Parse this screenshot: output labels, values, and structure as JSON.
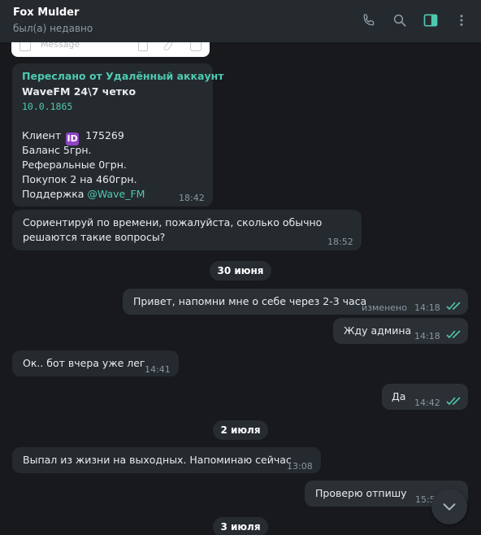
{
  "header": {
    "title": "Fox Mulder",
    "status": "был(а) недавно"
  },
  "partial_top": {
    "placeholder": "Message"
  },
  "forward": {
    "label": "Переслано от Удалённый аккаунт",
    "line1": "WaveFM 24\\7 четко",
    "ip": "10.0.1865",
    "client_label": "Клиент",
    "client_id_badge": "ID",
    "client_number": "175269",
    "balance": "Баланс 5грн.",
    "referral": "Реферальные 0грн.",
    "purchases": "Покупок 2 на 460грн.",
    "support_label": "Поддержка",
    "support_handle": "@Wave_FM",
    "time": "18:42"
  },
  "messages": [
    {
      "text1": "Сориентируй по времени, пожалуйста, сколько обычно",
      "text2": "решаются такие вопросы?",
      "time": "18:52"
    },
    {
      "date": "30 июня"
    },
    {
      "text": "Привет, напомни мне о себе через 2-3 часа",
      "edited": "изменено",
      "time": "14:18"
    },
    {
      "text": "Жду админа",
      "time": "14:18"
    },
    {
      "text": "Ок.. бот вчера уже лег",
      "time": "14:41"
    },
    {
      "text": "Да",
      "time": "14:42"
    },
    {
      "date": "2 июля"
    },
    {
      "text": "Выпал из жизни на выходных. Напоминаю сейчас",
      "time": "13:08"
    },
    {
      "text": "Проверю отпишу",
      "time": "15:5"
    },
    {
      "date": "3 июля"
    }
  ],
  "colors": {
    "accent": "#4ec9b0",
    "background": "#17191d",
    "bubble": "#252a2f"
  },
  "icons": [
    "phone-icon",
    "search-icon",
    "sidebar-toggle-icon",
    "more-vertical-icon",
    "chevron-down-icon"
  ]
}
